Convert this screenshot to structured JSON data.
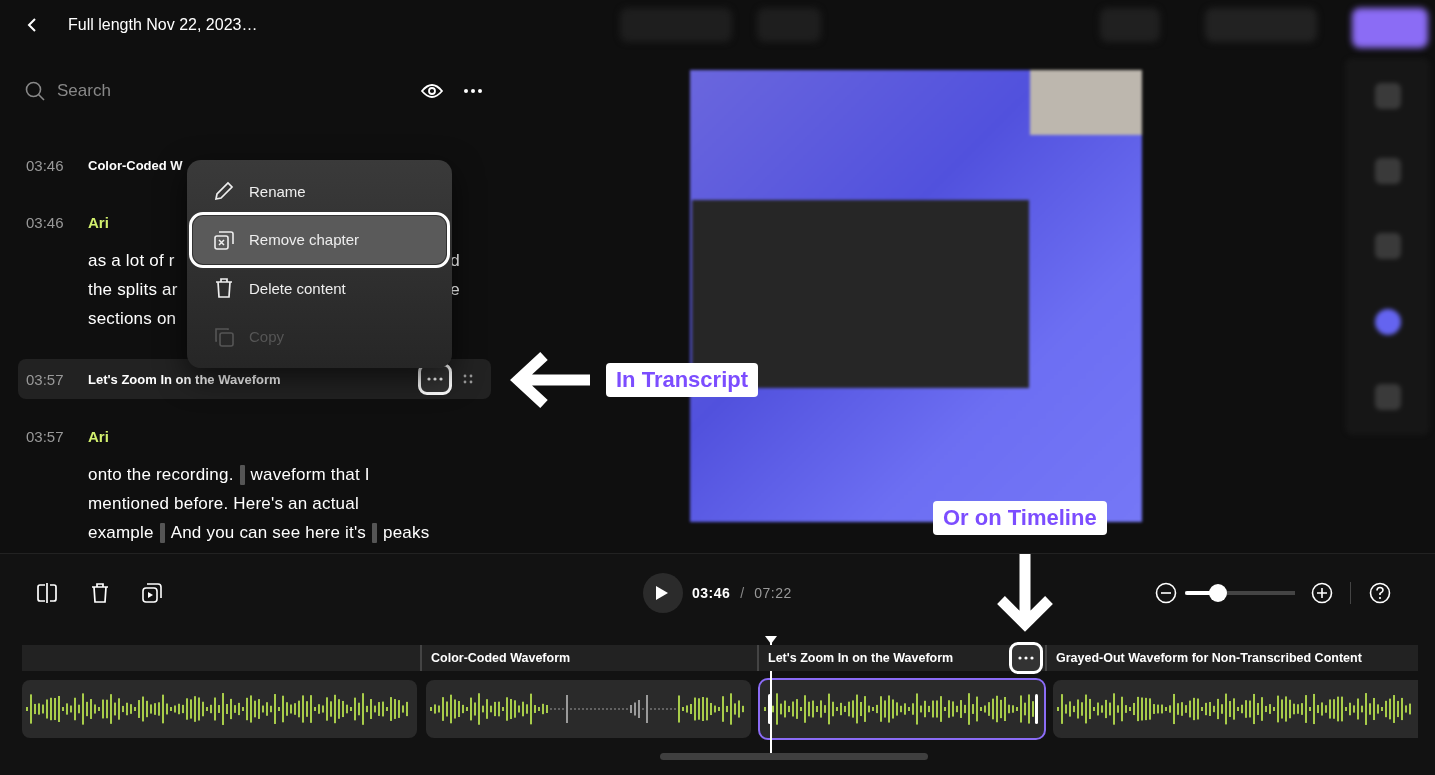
{
  "header": {
    "title": "Full length Nov 22, 2023…"
  },
  "search": {
    "placeholder": "Search"
  },
  "transcript": [
    {
      "kind": "chapter",
      "time": "03:46",
      "title": "Color-Coded W",
      "highlighted": false
    },
    {
      "kind": "speech",
      "time": "03:46",
      "speaker": "Ari",
      "lines": [
        {
          "segments": [
            "as a lot of r"
          ],
          "right": "d"
        },
        {
          "segments": [
            "the splits ar"
          ],
          "right": "e"
        },
        {
          "segments": [
            "sections on"
          ]
        }
      ]
    },
    {
      "kind": "chapter",
      "time": "03:57",
      "title": "Let's Zoom In on the Waveform",
      "highlighted": true
    },
    {
      "kind": "speech",
      "time": "03:57",
      "speaker": "Ari",
      "lines": [
        {
          "segments": [
            "onto the recording.",
            "waveform that I"
          ]
        },
        {
          "segments": [
            "mentioned before. Here's an actual"
          ]
        },
        {
          "segments": [
            "example",
            "And you can see here it's",
            "peaks"
          ]
        }
      ]
    }
  ],
  "menu": {
    "items": [
      {
        "kind": "rename",
        "label": "Rename",
        "selected": false,
        "disabled": false
      },
      {
        "kind": "remove",
        "label": "Remove chapter",
        "selected": true,
        "disabled": false
      },
      {
        "kind": "delete",
        "label": "Delete content",
        "selected": false,
        "disabled": false
      },
      {
        "kind": "copy",
        "label": "Copy",
        "selected": false,
        "disabled": true
      }
    ]
  },
  "callouts": [
    {
      "label": "In Transcript"
    },
    {
      "label": "Or on Timeline"
    }
  ],
  "player": {
    "current": "03:46",
    "separator": "/",
    "total": "07:22",
    "zoom": {
      "level": 0.3
    }
  },
  "timeline": {
    "chapters": [
      {
        "title": "Color-Coded Waveform"
      },
      {
        "title": "Let's Zoom In on the Waveform"
      },
      {
        "title": "Grayed-Out Waveform for Non-Transcribed Content"
      }
    ],
    "clips": [
      {
        "selected": false
      },
      {
        "selected": false
      },
      {
        "selected": true
      },
      {
        "selected": false
      }
    ]
  }
}
